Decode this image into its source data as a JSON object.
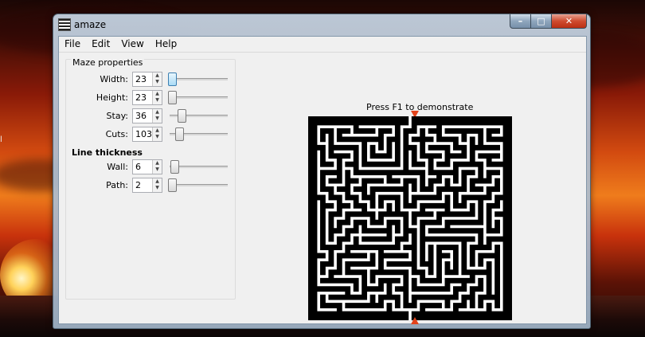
{
  "window": {
    "title": "amaze",
    "controls": {
      "minimize": "–",
      "maximize": "□",
      "close": "✕"
    }
  },
  "menu": [
    "File",
    "Edit",
    "View",
    "Help"
  ],
  "maze_properties": {
    "title": "Maze properties",
    "rows": [
      {
        "label": "Width:",
        "value": "23",
        "slider_pos": 0.0,
        "focused": true
      },
      {
        "label": "Height:",
        "value": "23",
        "slider_pos": 0.0,
        "focused": false
      },
      {
        "label": "Stay:",
        "value": "36",
        "slider_pos": 0.18,
        "focused": false
      },
      {
        "label": "Cuts:",
        "value": "103",
        "slider_pos": 0.14,
        "focused": false
      }
    ]
  },
  "line_thickness": {
    "title": "Line thickness",
    "rows": [
      {
        "label": "Wall:",
        "value": "6",
        "slider_pos": 0.05,
        "focused": false
      },
      {
        "label": "Path:",
        "value": "2",
        "slider_pos": 0.0,
        "focused": false
      }
    ]
  },
  "hint": "Press F1 to demonstrate",
  "colors": {
    "accent": "#e3431b",
    "wall": "#000000",
    "path": "#ffffff"
  },
  "desktop_left_text": "l"
}
